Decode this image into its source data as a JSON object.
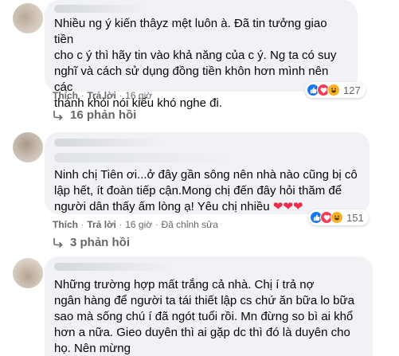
{
  "comments": [
    {
      "text": "Nhiều ng ý kiến thâyz mệt luôn à. Đã tin tưởng giao tiền\ncho c ý thì hãy tin vào khả năng của c ý. Ng ta có suy\nnghĩ và cách sử dụng đồng tiền khôn hơn mình nên các\nthánh khỏi nói kiểu khó nghe đi.",
      "reaction_count": "127",
      "actions": {
        "like": "Thích",
        "reply": "Trả lời",
        "time": "16 giờ"
      },
      "replies_label": "16 phản hồi"
    },
    {
      "text": "Ninh chị Tiên ơi...ở đây gần sông nên nhà nào cũng bị cô\nlập hết, ít đoàn tiếp cận.Mong chị đến đây hỏi thăm để\nngười dân thấy ấm lòng ạ! Yêu chị nhiều ",
      "hearts": "❤❤❤",
      "reaction_count": "151",
      "actions": {
        "like": "Thích",
        "reply": "Trả lời",
        "time": "16 giờ",
        "edited": "Đã chỉnh sửa"
      },
      "replies_label": "3 phản hồi"
    },
    {
      "text": "Những trường hợp mất trắng cả nhà. Chị í trả nợ\nngân hàng để người ta tái thiết lập cs chứ ăn bữa lo bữa\nsao mà sống chú í đã ngót tuổi rồi. Mn đừng so bì ai khổ\nhơn a nữa. Gieo duyên thì ai gặp dc thì đó là duyên cho\nhọ. Nên mừng"
    }
  ],
  "colors": {
    "bubble": "#f0f2f5",
    "meta_text": "#65676b",
    "like": "#1877f2",
    "love": "#f33e58",
    "haha": "#f7b125"
  }
}
